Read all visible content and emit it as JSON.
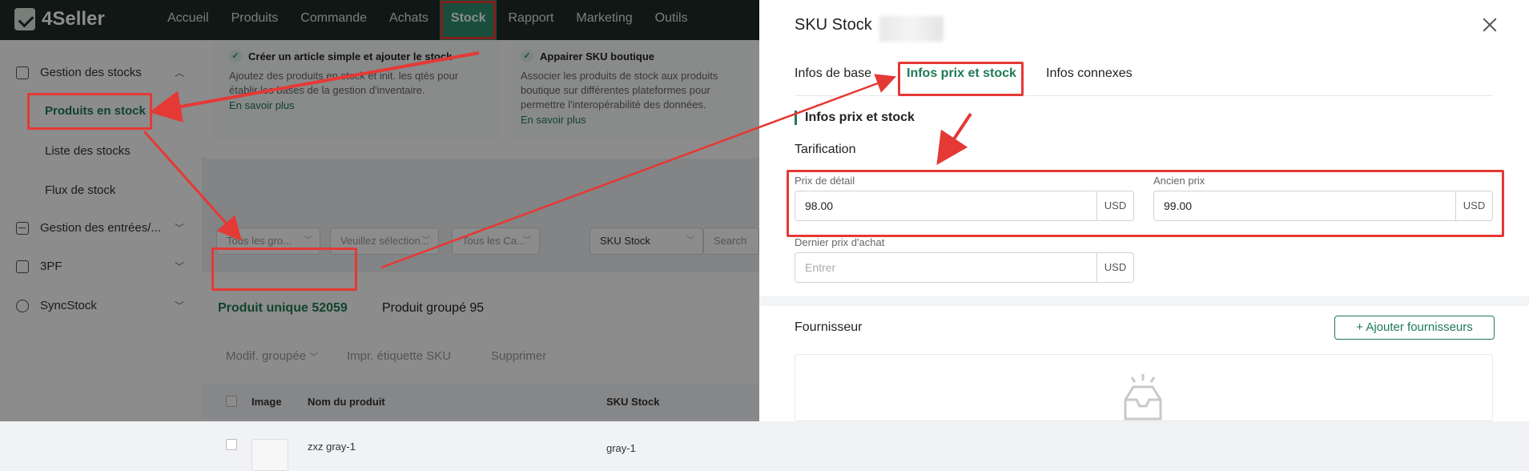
{
  "app": {
    "logo_text": "4Seller"
  },
  "nav": {
    "items": [
      {
        "label": "Accueil"
      },
      {
        "label": "Produits"
      },
      {
        "label": "Commande"
      },
      {
        "label": "Achats"
      },
      {
        "label": "Stock"
      },
      {
        "label": "Rapport"
      },
      {
        "label": "Marketing"
      },
      {
        "label": "Outils"
      }
    ],
    "active": "Stock"
  },
  "sidebar": {
    "groups": [
      {
        "label": "Gestion des stocks",
        "icon": "inventory-icon",
        "expanded": true
      },
      {
        "label": "Gestion des entrées/...",
        "icon": "inbound-icon"
      },
      {
        "label": "3PF",
        "icon": "3pf-icon"
      },
      {
        "label": "SyncStock",
        "icon": "sync-icon"
      }
    ],
    "sub_items": [
      {
        "label": "Produits en stock",
        "active": true
      },
      {
        "label": "Liste des stocks"
      },
      {
        "label": "Flux de stock"
      }
    ]
  },
  "tips": [
    {
      "title": "Créer un article simple et ajouter le stock",
      "desc1": "Ajoutez des produits en stock et init. les qtés pour",
      "desc2": "établir les bases de la gestion d'inventaire.",
      "link": "En savoir plus"
    },
    {
      "title": "Appairer SKU boutique",
      "desc1": "Associer les produits de stock aux produits",
      "desc2": "boutique sur différentes plateformes pour",
      "desc3": "permettre l'interopérabilité des données.",
      "link": "En savoir plus"
    }
  ],
  "filters": {
    "group": "Tous les gro...",
    "select": "Veuillez sélection...",
    "category": "Tous les Ca...",
    "sku_type": "SKU Stock",
    "search": "Search"
  },
  "product_tabs": {
    "single": "Produit unique 52059",
    "grouped": "Produit groupé 95"
  },
  "bulk_actions": {
    "modify": "Modif. groupée",
    "print": "Impr. étiquette SKU",
    "delete": "Supprimer"
  },
  "table": {
    "headers": [
      "Image",
      "Nom du produit",
      "SKU Stock"
    ],
    "rows": [
      {
        "name": "zxz gray-1",
        "sku": "gray-1"
      }
    ]
  },
  "drawer": {
    "title": "SKU Stock",
    "tabs": [
      "Infos de base",
      "Infos prix et stock",
      "Infos connexes"
    ],
    "active_tab": "Infos prix et stock",
    "section_title": "Infos prix et stock",
    "pricing_heading": "Tarification",
    "retail_label": "Prix de détail",
    "retail_value": "98.00",
    "old_label": "Ancien prix",
    "old_value": "99.00",
    "last_purchase_label": "Dernier prix d'achat",
    "last_purchase_placeholder": "Entrer",
    "currency": "USD",
    "supplier_title": "Fournisseur",
    "add_supplier": "+ Ajouter fournisseurs"
  },
  "colors": {
    "brand_green": "#1f7a55",
    "annotation_red": "#e53935",
    "topbar": "#1e2a26"
  }
}
